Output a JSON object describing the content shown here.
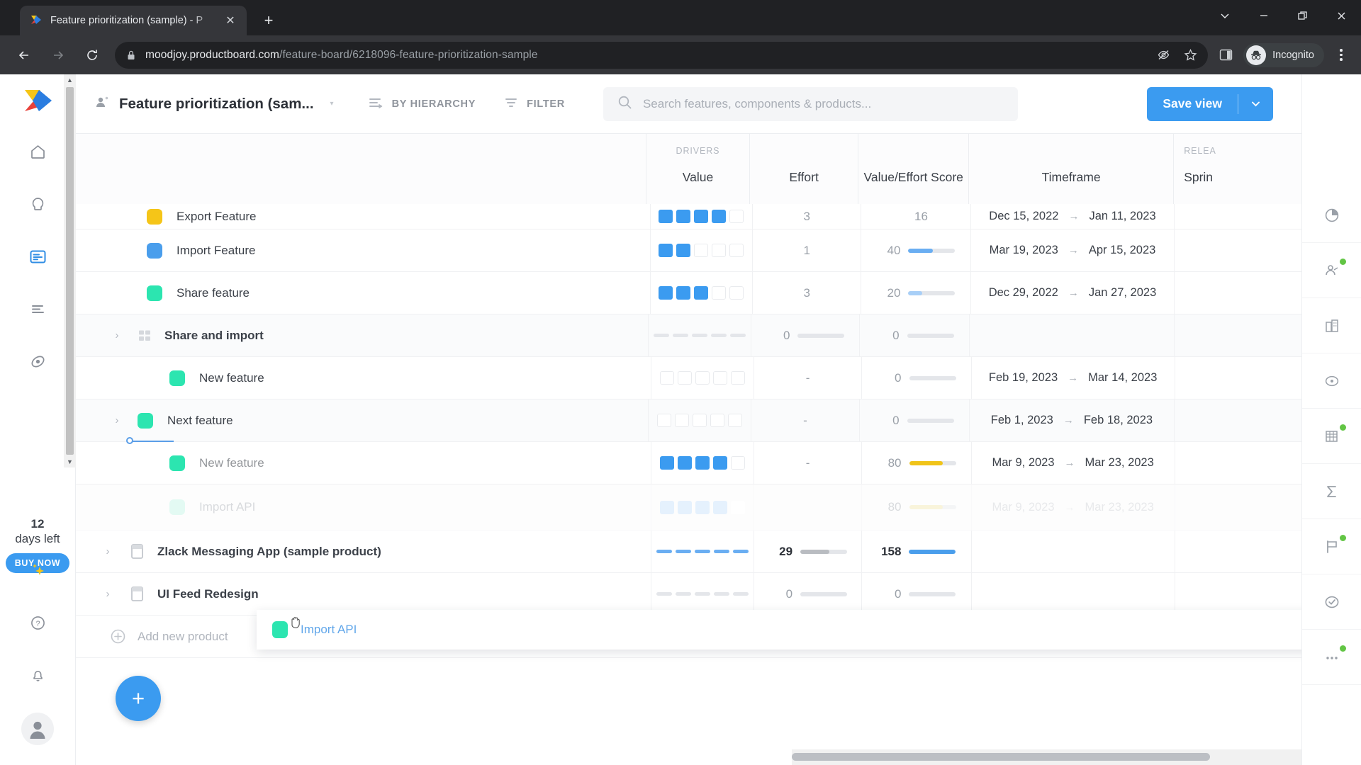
{
  "browser": {
    "tab": {
      "title": "Feature prioritization (sample) - P",
      "close_label": "✕",
      "favicon": "productboard-favicon"
    },
    "newtab_label": "+",
    "window_controls": {
      "minimize": "—",
      "maximize": "❐",
      "close": "✕",
      "more": "⌄"
    },
    "nav": {
      "back": "←",
      "forward": "→",
      "reload": "↻"
    },
    "url": {
      "host": "moodjoy.productboard.com",
      "path": "/feature-board/6218096-feature-prioritization-sample"
    },
    "profile": {
      "label": "Incognito"
    }
  },
  "sidebar": {
    "logo": "productboard-logo",
    "items": [
      {
        "name": "home",
        "icon": "home-icon",
        "active": false
      },
      {
        "name": "insights",
        "icon": "lightbulb-icon",
        "active": false
      },
      {
        "name": "features",
        "icon": "features-board-icon",
        "active": true
      },
      {
        "name": "roadmaps",
        "icon": "roadmap-lines-icon",
        "active": false
      },
      {
        "name": "portal",
        "icon": "portal-icon",
        "active": false
      }
    ],
    "trial": {
      "days": "12",
      "label": "days left",
      "cta": "BUY NOW"
    },
    "bottom_items": [
      {
        "name": "ai-sparkles",
        "icon": "sparkles-icon"
      },
      {
        "name": "help",
        "icon": "question-circle-icon"
      },
      {
        "name": "notifications",
        "icon": "bell-icon"
      },
      {
        "name": "account",
        "icon": "avatar-icon"
      }
    ]
  },
  "header": {
    "view_icon": "people-view-icon",
    "view_name": "Feature prioritization (sam...",
    "view_caret": "▾",
    "hierarchy_button": "BY HIERARCHY",
    "filter_button": "FILTER",
    "search_placeholder": "Search features, components & products...",
    "save_view_label": "Save view",
    "save_view_caret": "⌄",
    "accent_color": "#3b9bf0"
  },
  "table": {
    "group_labels": {
      "drivers": "DRIVERS",
      "release": "RELEA"
    },
    "columns": [
      {
        "key": "name",
        "title": ""
      },
      {
        "key": "value",
        "title": "Value",
        "group": "DRIVERS"
      },
      {
        "key": "effort",
        "title": "Effort"
      },
      {
        "key": "score",
        "title": "Value/Effort Score"
      },
      {
        "key": "timeframe",
        "title": "Timeframe"
      },
      {
        "key": "sprint",
        "title": "Sprin",
        "group": "RELEA"
      }
    ],
    "rows": [
      {
        "name": "Export Feature",
        "type": "feature",
        "swatch": "#f5c518",
        "indent": 1,
        "expandable": false,
        "clipped": true,
        "value_filled": 4,
        "value_total": 5,
        "effort": "3",
        "score": "16",
        "score_pct": 16,
        "start": "Dec 15, 2022",
        "end": "Jan 11, 2023"
      },
      {
        "name": "Import Feature",
        "type": "feature",
        "swatch": "#4a9eec",
        "indent": 1,
        "expandable": false,
        "value_filled": 2,
        "value_total": 5,
        "effort": "1",
        "score": "40",
        "score_pct": 52,
        "score_color": "#6aaef2",
        "start": "Mar 19, 2023",
        "end": "Apr 15, 2023"
      },
      {
        "name": "Share feature",
        "type": "feature",
        "swatch": "#2ce5b0",
        "indent": 1,
        "expandable": false,
        "value_filled": 3,
        "value_total": 5,
        "effort": "3",
        "score": "20",
        "score_pct": 30,
        "score_color": "#a8cff7",
        "start": "Dec 29, 2022",
        "end": "Jan 27, 2023"
      },
      {
        "name": "Share and import",
        "type": "component",
        "icon": "component-grid-icon",
        "indent": 0,
        "expandable": true,
        "bold": true,
        "value_style": "dash",
        "value_filled": 0,
        "value_total": 5,
        "effort": "0",
        "effort_muted": true,
        "score": "0",
        "score_pct": 0,
        "score_muted": true,
        "start": "",
        "end": ""
      },
      {
        "name": "New feature",
        "type": "feature",
        "swatch": "#2ce5b0",
        "indent": 1,
        "expandable": false,
        "value_style": "empty",
        "value_filled": 0,
        "value_total": 5,
        "effort": "-",
        "effort_muted": true,
        "score": "0",
        "score_pct": 0,
        "score_muted": true,
        "start": "Feb 19, 2023",
        "end": "Mar 14, 2023"
      },
      {
        "name": "Next feature",
        "type": "feature",
        "swatch": "#2ce5b0",
        "indent": 1,
        "expandable": true,
        "value_style": "empty",
        "value_filled": 0,
        "value_total": 5,
        "effort": "-",
        "effort_muted": true,
        "score": "0",
        "score_pct": 0,
        "score_muted": true,
        "start": "Feb 1, 2023",
        "end": "Feb 18, 2023"
      },
      {
        "name": "New feature",
        "type": "feature",
        "swatch": "#2ce5b0",
        "indent": 1,
        "expandable": false,
        "obscured": true,
        "value_filled": 4,
        "value_total": 5,
        "effort": "-",
        "effort_muted": true,
        "score": "80",
        "score_pct": 72,
        "score_color": "#f0c419",
        "start": "Mar 9, 2023",
        "end": "Mar 23, 2023"
      },
      {
        "name": "Import API",
        "type": "feature",
        "swatch": "#b8f3e0",
        "indent": 1,
        "expandable": false,
        "ghost": true,
        "value_filled": 4,
        "value_total": 5,
        "value_ghost": true,
        "effort": "",
        "score": "80",
        "score_pct": 72,
        "score_color": "#f0e3a2",
        "score_muted": true,
        "start": "Mar 9, 2023",
        "end": "Mar 23, 2023",
        "timeframe_muted": true
      },
      {
        "name": "Zlack Messaging App (sample product)",
        "type": "product",
        "icon": "product-card-icon",
        "indent": 0,
        "expandable": true,
        "bold": true,
        "value_style": "dash",
        "value_filled": 5,
        "value_total": 5,
        "effort": "29",
        "effort_dark": true,
        "effort_pct": 55,
        "score": "158",
        "score_pct": 100,
        "score_color": "#4a9eec",
        "score_dark": true,
        "start": "",
        "end": ""
      },
      {
        "name": "UI Feed Redesign",
        "type": "product",
        "icon": "product-card-icon",
        "indent": 0,
        "expandable": true,
        "bold": true,
        "value_style": "dash",
        "value_filled": 0,
        "value_total": 5,
        "effort": "0",
        "effort_muted": true,
        "score": "0",
        "score_pct": 0,
        "score_muted": true,
        "start": "",
        "end": ""
      }
    ],
    "add_product_label": "Add new product",
    "add_product_icon": "plus-circle-icon",
    "fab_label": "+"
  },
  "drag": {
    "active": true,
    "card_label": "Import API",
    "card_swatch": "#2ce5b0",
    "cursor": "grab-hand-cursor",
    "drop_indicator_color": "#5a9ee8"
  },
  "right_rail": {
    "items": [
      {
        "name": "insights-pie",
        "icon": "pie-chart-icon",
        "badge": false
      },
      {
        "name": "customer-needs",
        "icon": "person-node-icon",
        "badge": true
      },
      {
        "name": "companies",
        "icon": "building-icon",
        "badge": false
      },
      {
        "name": "objectives",
        "icon": "target-icon",
        "badge": false
      },
      {
        "name": "segments",
        "icon": "grid-building-icon",
        "badge": true
      },
      {
        "name": "formula",
        "icon": "sigma-icon",
        "badge": false
      },
      {
        "name": "releases",
        "icon": "flag-icon",
        "badge": true
      },
      {
        "name": "status",
        "icon": "check-circle-icon",
        "badge": false
      },
      {
        "name": "more-columns",
        "icon": "more-dots-icon",
        "badge": true
      }
    ],
    "badge_color": "#62c544"
  }
}
